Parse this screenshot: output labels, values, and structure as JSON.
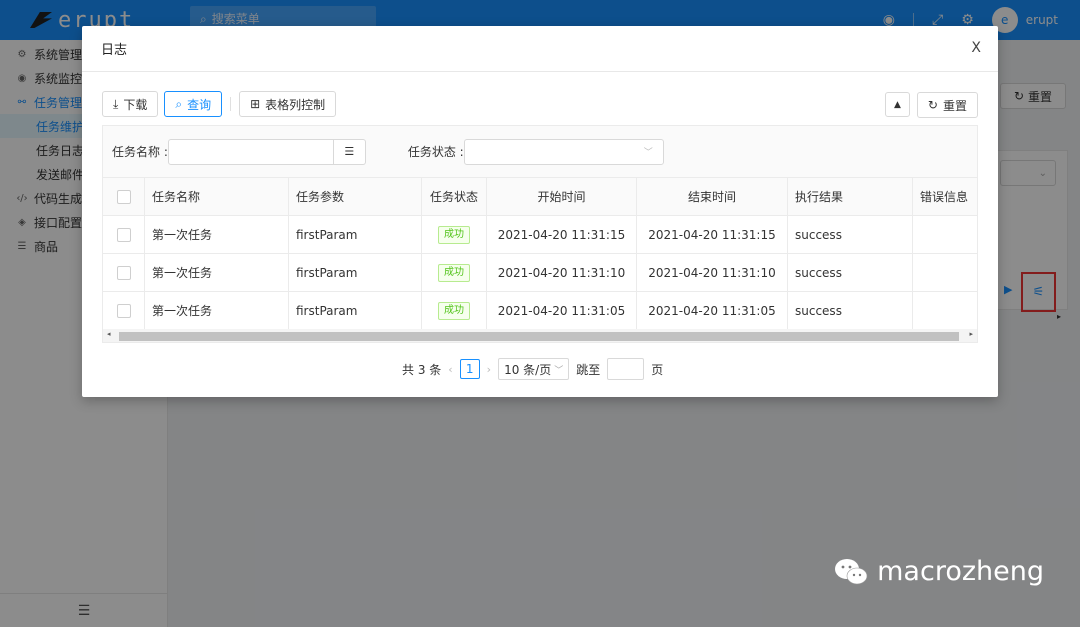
{
  "app": {
    "logo_text": "erupt"
  },
  "topbar": {
    "search_placeholder": "搜索菜单",
    "user_initial": "e",
    "user_name": "erupt",
    "icons": [
      "github-icon",
      "fullscreen-icon",
      "settings-icon"
    ]
  },
  "sidebar": {
    "items": [
      {
        "label": "系统管理",
        "icon": "gear-icon",
        "level": 1,
        "active": false
      },
      {
        "label": "系统监控",
        "icon": "monitor-icon",
        "level": 1,
        "active": false
      },
      {
        "label": "任务管理",
        "icon": "task-icon",
        "level": 1,
        "active": true
      },
      {
        "label": "任务维护",
        "level": 2,
        "active": true
      },
      {
        "label": "任务日志",
        "level": 2,
        "active": false
      },
      {
        "label": "发送邮件",
        "level": 2,
        "active": false
      },
      {
        "label": "代码生成",
        "icon": "code-icon",
        "level": 1,
        "active": false
      },
      {
        "label": "接口配置",
        "icon": "api-icon",
        "level": 1,
        "active": false
      },
      {
        "label": "商品",
        "icon": "list-icon",
        "level": 1,
        "active": false
      }
    ]
  },
  "background": {
    "reset_label": "重置"
  },
  "modal": {
    "title": "日志",
    "close_label": "X",
    "toolbar": {
      "download_label": "下载",
      "query_label": "查询",
      "columns_label": "表格列控制",
      "reset_label": "重置"
    },
    "search": {
      "task_name_label": "任务名称 :",
      "task_status_label": "任务状态 :"
    },
    "table": {
      "columns": [
        "任务名称",
        "任务参数",
        "任务状态",
        "开始时间",
        "结束时间",
        "执行结果",
        "错误信息"
      ],
      "rows": [
        {
          "name": "第一次任务",
          "param": "firstParam",
          "status": "成功",
          "start": "2021-04-20 11:31:15",
          "end": "2021-04-20 11:31:15",
          "result": "success",
          "error": ""
        },
        {
          "name": "第一次任务",
          "param": "firstParam",
          "status": "成功",
          "start": "2021-04-20 11:31:10",
          "end": "2021-04-20 11:31:10",
          "result": "success",
          "error": ""
        },
        {
          "name": "第一次任务",
          "param": "firstParam",
          "status": "成功",
          "start": "2021-04-20 11:31:05",
          "end": "2021-04-20 11:31:05",
          "result": "success",
          "error": ""
        }
      ]
    },
    "pagination": {
      "total_text": "共 3 条",
      "current_page": "1",
      "page_size": "10 条/页",
      "jump_label": "跳至",
      "page_label": "页"
    }
  },
  "watermark": {
    "text": "macrozheng"
  },
  "colors": {
    "primary": "#1890ff",
    "success": "#52c41a",
    "highlight": "#e33333"
  }
}
